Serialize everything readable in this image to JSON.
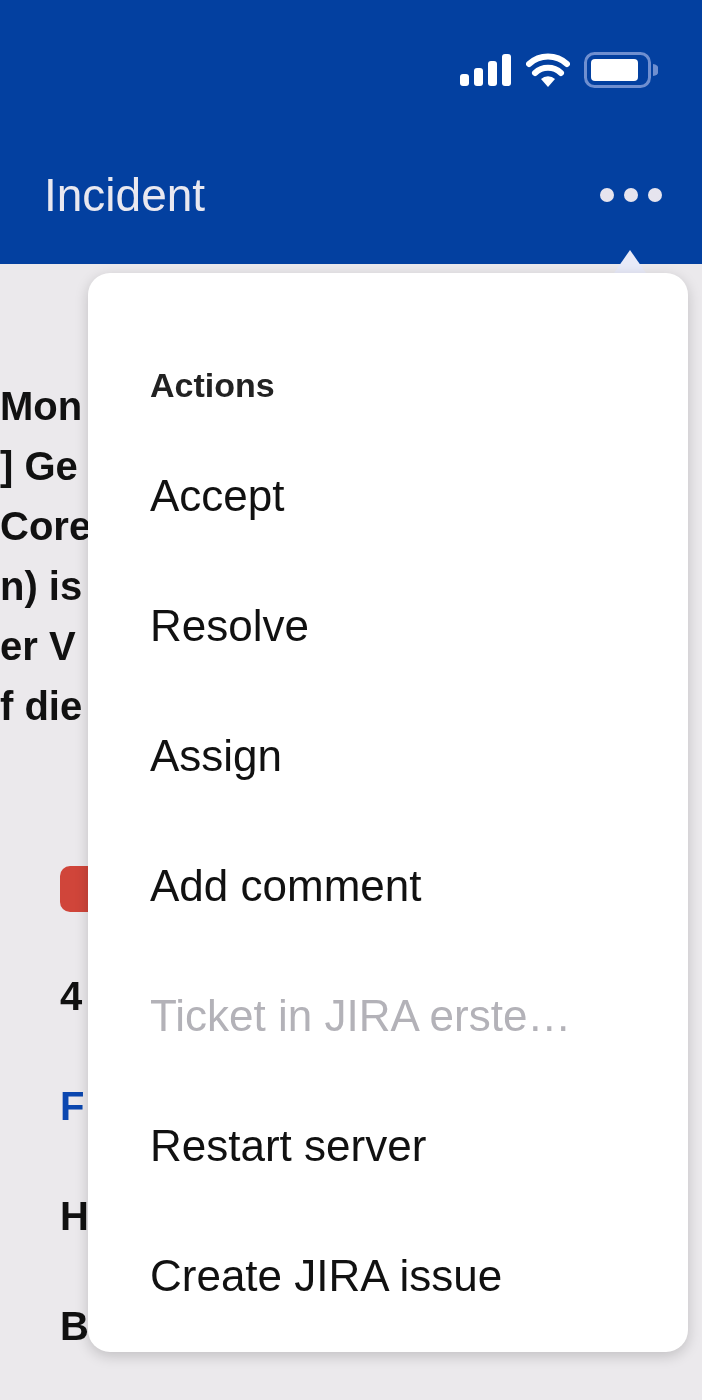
{
  "header": {
    "title": "Incident"
  },
  "background": {
    "description_lines": [
      "Mon",
      "] Ge",
      "Core",
      "n) is",
      "er V",
      "f die"
    ],
    "fields": [
      {
        "kind": "badge"
      },
      {
        "kind": "text",
        "text": "4"
      },
      {
        "kind": "link",
        "text": "F"
      },
      {
        "kind": "text",
        "text": "H"
      },
      {
        "kind": "text",
        "text": "B"
      }
    ]
  },
  "menu": {
    "heading": "Actions",
    "items": [
      {
        "label": "Accept",
        "disabled": false
      },
      {
        "label": "Resolve",
        "disabled": false
      },
      {
        "label": "Assign",
        "disabled": false
      },
      {
        "label": "Add comment",
        "disabled": false
      },
      {
        "label": "Ticket in JIRA erste…",
        "disabled": true
      },
      {
        "label": "Restart server",
        "disabled": false
      },
      {
        "label": "Create JIRA issue",
        "disabled": false
      }
    ]
  }
}
